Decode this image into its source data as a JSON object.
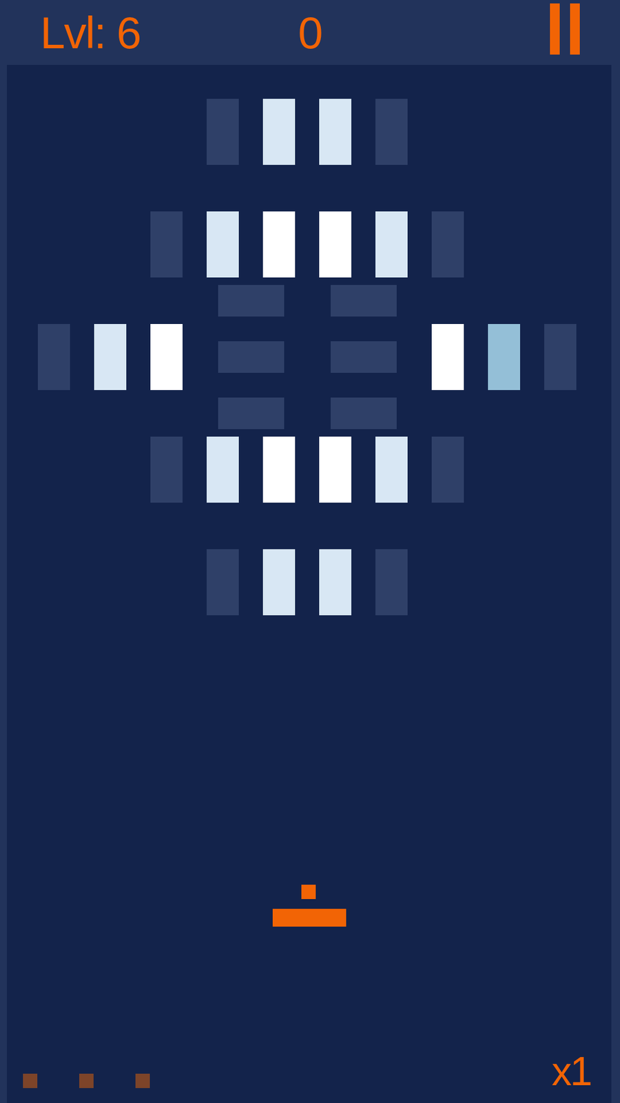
{
  "header": {
    "level": "Lvl: 6",
    "score": "0"
  },
  "bricks": [
    {
      "row": 0,
      "col": 6,
      "kind": "vertical",
      "color": "#2f4068"
    },
    {
      "row": 0,
      "col": 8,
      "kind": "vertical",
      "color": "#d8e7f4"
    },
    {
      "row": 0,
      "col": 10,
      "kind": "vertical",
      "color": "#d8e7f4"
    },
    {
      "row": 0,
      "col": 12,
      "kind": "vertical",
      "color": "#2f4068"
    },
    {
      "row": 4,
      "col": 4,
      "kind": "vertical",
      "color": "#2f4068"
    },
    {
      "row": 4,
      "col": 6,
      "kind": "vertical",
      "color": "#d8e7f4"
    },
    {
      "row": 4,
      "col": 8,
      "kind": "vertical",
      "color": "#ffffff"
    },
    {
      "row": 4,
      "col": 10,
      "kind": "vertical",
      "color": "#ffffff"
    },
    {
      "row": 4,
      "col": 12,
      "kind": "vertical",
      "color": "#d8e7f4"
    },
    {
      "row": 4,
      "col": 14,
      "kind": "vertical",
      "color": "#2f4068"
    },
    {
      "row": 7,
      "col": 6,
      "kind": "horizontal",
      "color": "#2f4068"
    },
    {
      "row": 7,
      "col": 10,
      "kind": "horizontal",
      "color": "#2f4068"
    },
    {
      "row": 8,
      "col": 0,
      "kind": "vertical",
      "color": "#2f4068"
    },
    {
      "row": 8,
      "col": 2,
      "kind": "vertical",
      "color": "#d8e7f4"
    },
    {
      "row": 8,
      "col": 4,
      "kind": "vertical",
      "color": "#ffffff"
    },
    {
      "row": 8,
      "col": 14,
      "kind": "vertical",
      "color": "#ffffff"
    },
    {
      "row": 8,
      "col": 16,
      "kind": "vertical",
      "color": "#94bfd7"
    },
    {
      "row": 8,
      "col": 18,
      "kind": "vertical",
      "color": "#2f4068"
    },
    {
      "row": 9,
      "col": 6,
      "kind": "horizontal",
      "color": "#2f4068"
    },
    {
      "row": 9,
      "col": 10,
      "kind": "horizontal",
      "color": "#2f4068"
    },
    {
      "row": 11,
      "col": 6,
      "kind": "horizontal",
      "color": "#2f4068"
    },
    {
      "row": 11,
      "col": 10,
      "kind": "horizontal",
      "color": "#2f4068"
    },
    {
      "row": 12,
      "col": 4,
      "kind": "vertical",
      "color": "#2f4068"
    },
    {
      "row": 12,
      "col": 6,
      "kind": "vertical",
      "color": "#d8e7f4"
    },
    {
      "row": 12,
      "col": 8,
      "kind": "vertical",
      "color": "#ffffff"
    },
    {
      "row": 12,
      "col": 10,
      "kind": "vertical",
      "color": "#ffffff"
    },
    {
      "row": 12,
      "col": 12,
      "kind": "vertical",
      "color": "#d8e7f4"
    },
    {
      "row": 12,
      "col": 14,
      "kind": "vertical",
      "color": "#2f4068"
    },
    {
      "row": 16,
      "col": 6,
      "kind": "vertical",
      "color": "#2f4068"
    },
    {
      "row": 16,
      "col": 8,
      "kind": "vertical",
      "color": "#d8e7f4"
    },
    {
      "row": 16,
      "col": 10,
      "kind": "vertical",
      "color": "#d8e7f4"
    },
    {
      "row": 16,
      "col": 12,
      "kind": "vertical",
      "color": "#2f4068"
    }
  ],
  "lives": [
    {
      "remaining": true
    },
    {
      "remaining": true
    },
    {
      "remaining": true
    }
  ],
  "multiplier": "x1"
}
